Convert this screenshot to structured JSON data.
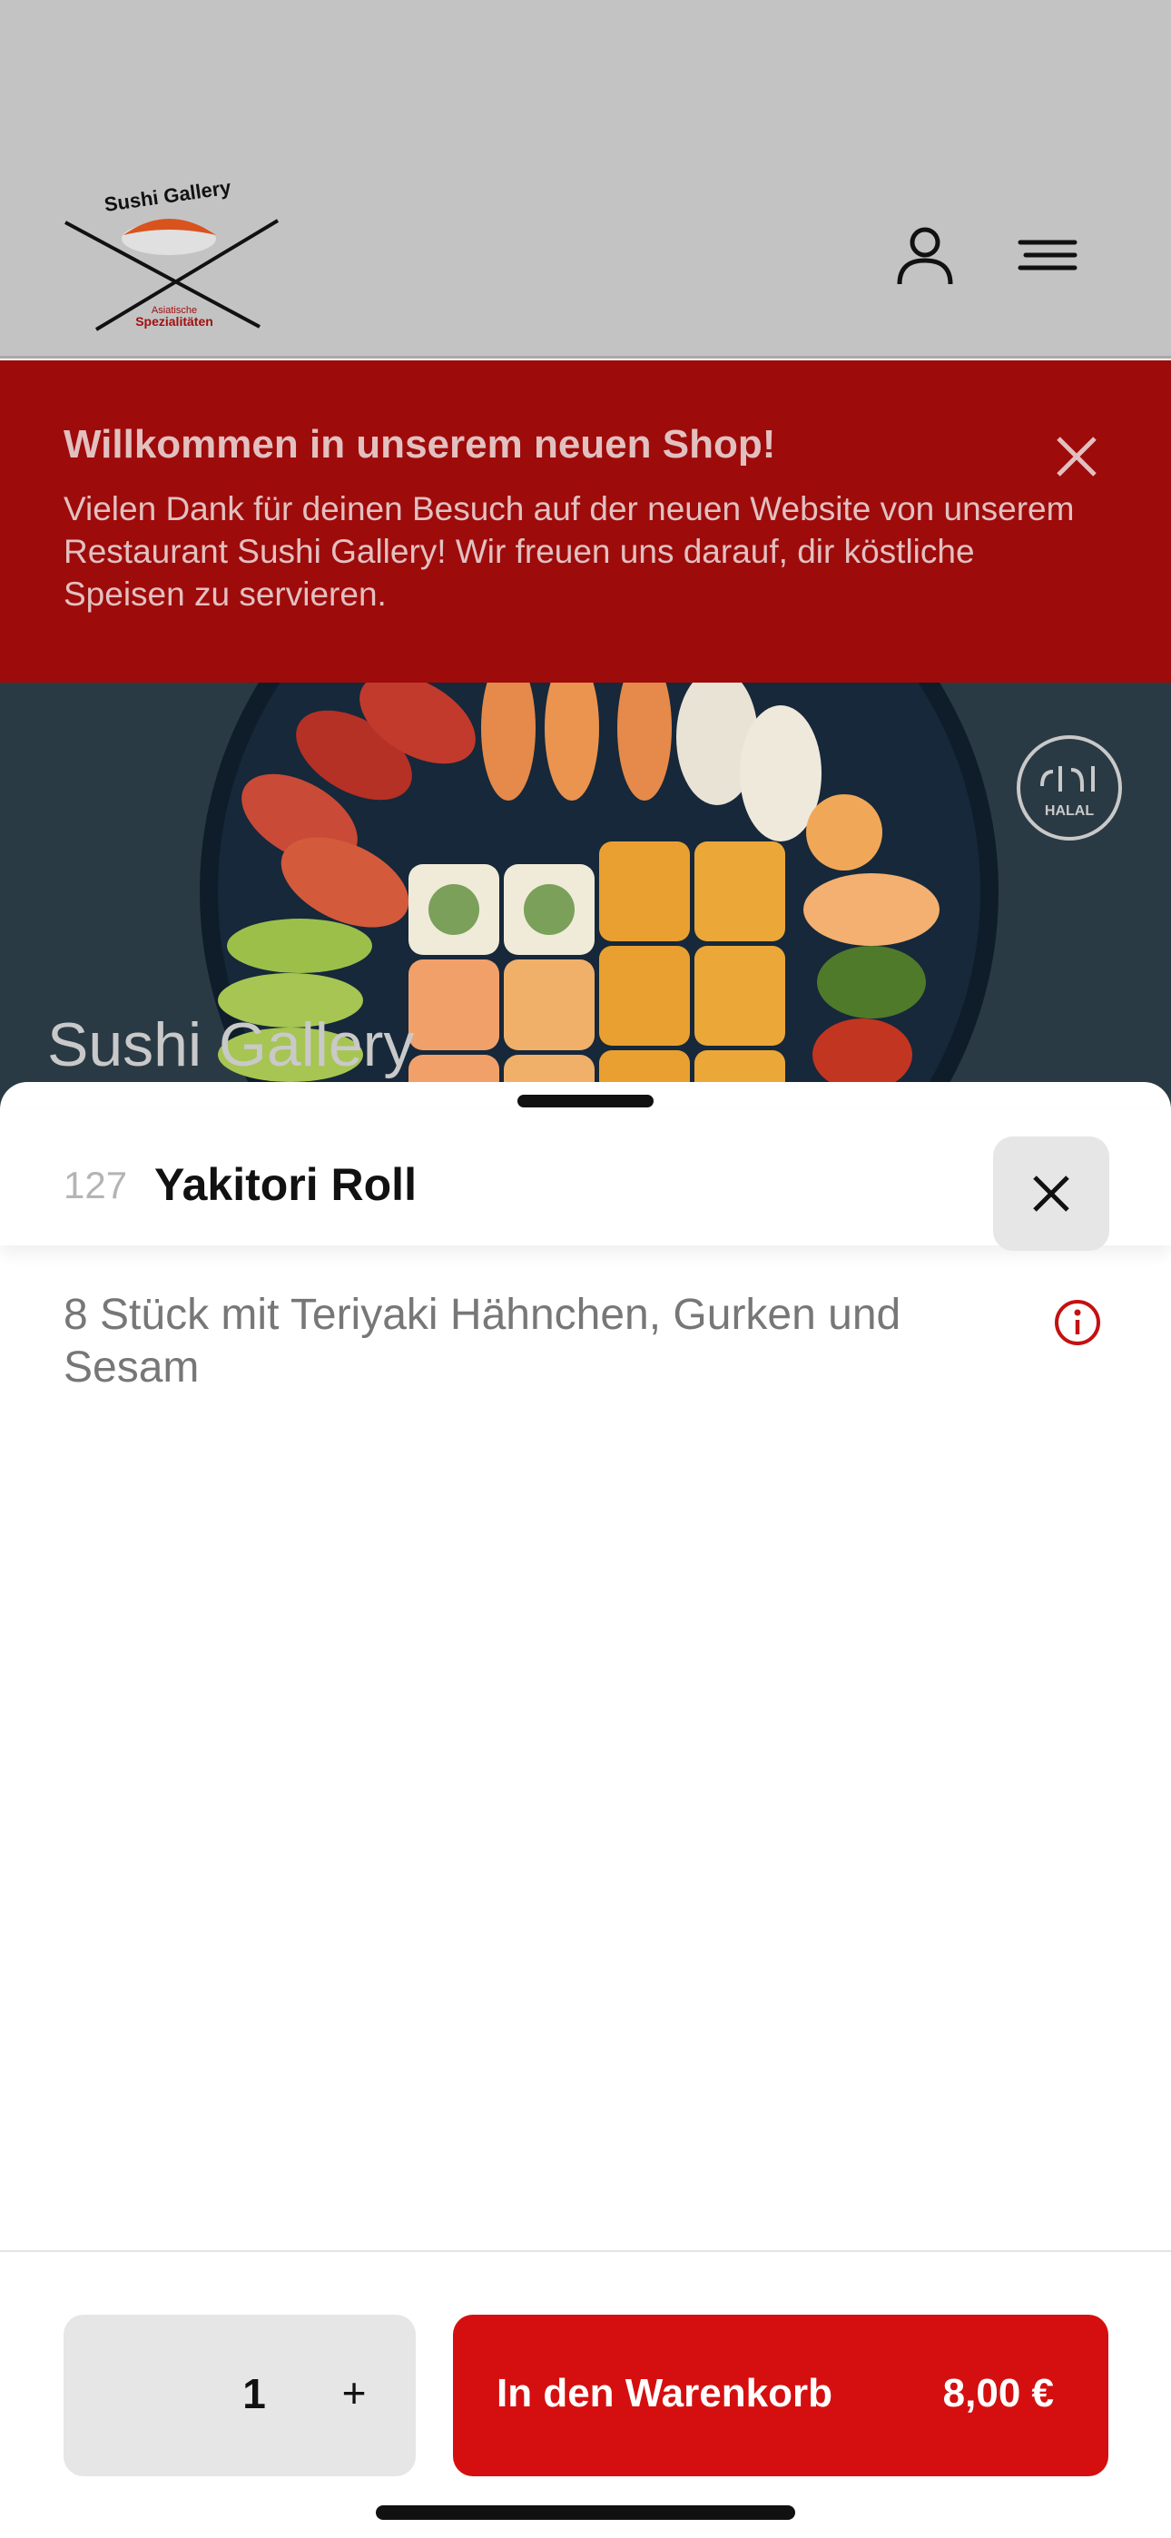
{
  "header": {
    "logo_text": "Sushi Gallery",
    "logo_subtext": "Asiatische Spezialitäten",
    "account_icon": "person-icon",
    "menu_icon": "hamburger-menu-icon"
  },
  "banner": {
    "title": "Willkommen in unserem neuen Shop!",
    "text": "Vielen Dank für deinen Besuch auf der neuen Website von unserem Restaurant Sushi Gallery! Wir freuen uns darauf, dir köstliche Speisen zu servieren.",
    "close_icon": "close-icon",
    "bg_color": "#9e0b0b"
  },
  "hero": {
    "title": "Sushi Gallery",
    "badge_text": "HALAL",
    "badge_icon": "halal-icon"
  },
  "sheet": {
    "item_number": "127",
    "item_name": "Yakitori Roll",
    "close_icon": "close-icon",
    "description": "8 Stück mit Teriyaki Hähnchen, Gurken und Sesam",
    "info_icon": "info-icon",
    "quantity": "1",
    "plus_label": "+",
    "add_to_cart_label": "In den Warenkorb",
    "price": "8,00 €",
    "accent_color": "#d50f0f"
  }
}
